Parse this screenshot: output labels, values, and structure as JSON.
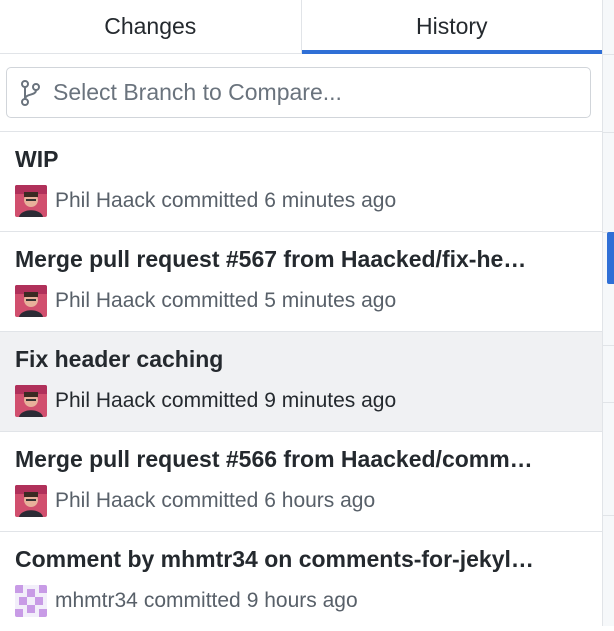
{
  "tabs": [
    {
      "label": "Changes",
      "active": false
    },
    {
      "label": "History",
      "active": true
    }
  ],
  "branch_compare": {
    "placeholder": "Select Branch to Compare...",
    "icon": "git-branch-icon"
  },
  "accent_color": "#2f6fd6",
  "commits": [
    {
      "title": "WIP",
      "author": "Phil Haack",
      "verb": "committed",
      "time": "6 minutes ago",
      "avatar": "phil-haack-avatar",
      "selected": false
    },
    {
      "title": "Merge pull request #567 from Haacked/fix-he…",
      "author": "Phil Haack",
      "verb": "committed",
      "time": "5 minutes ago",
      "avatar": "phil-haack-avatar",
      "selected": false
    },
    {
      "title": "Fix header caching",
      "author": "Phil Haack",
      "verb": "committed",
      "time": "9 minutes ago",
      "avatar": "phil-haack-avatar",
      "selected": true
    },
    {
      "title": "Merge pull request #566 from Haacked/comm…",
      "author": "Phil Haack",
      "verb": "committed",
      "time": "6 hours ago",
      "avatar": "phil-haack-avatar",
      "selected": false
    },
    {
      "title": "Comment by mhmtr34 on comments-for-jekyl…",
      "author": "mhmtr34",
      "verb": "committed",
      "time": "9 hours ago",
      "avatar": "identicon-avatar",
      "selected": false
    }
  ]
}
